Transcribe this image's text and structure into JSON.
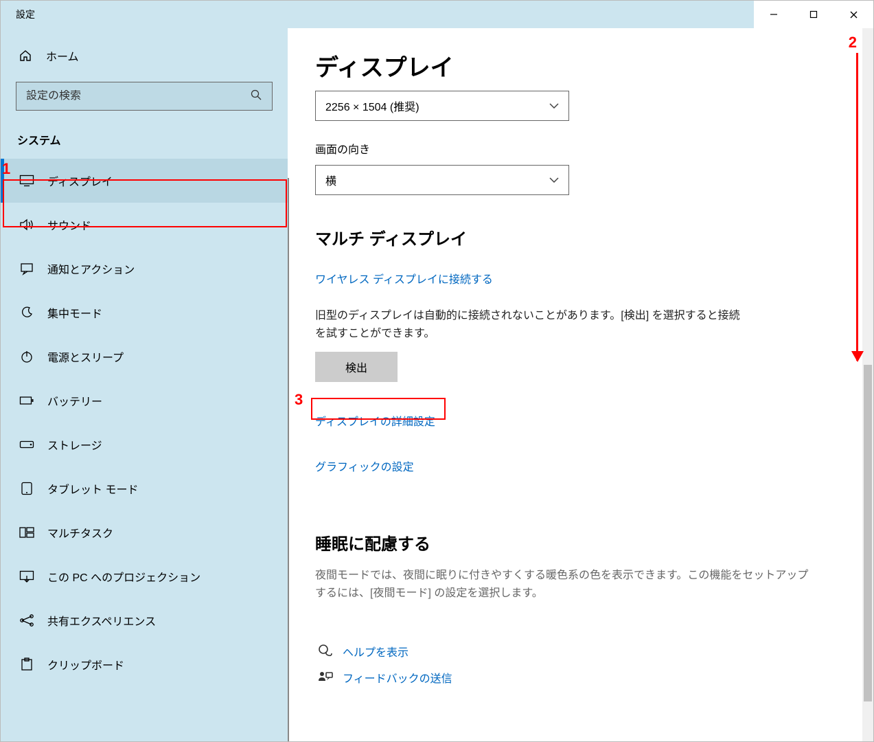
{
  "window": {
    "title": "設定"
  },
  "sidebar": {
    "home": "ホーム",
    "search_placeholder": "設定の検索",
    "section": "システム",
    "items": [
      {
        "id": "display",
        "label": "ディスプレイ",
        "selected": true
      },
      {
        "id": "sound",
        "label": "サウンド"
      },
      {
        "id": "notifications",
        "label": "通知とアクション"
      },
      {
        "id": "focus",
        "label": "集中モード"
      },
      {
        "id": "power",
        "label": "電源とスリープ"
      },
      {
        "id": "battery",
        "label": "バッテリー"
      },
      {
        "id": "storage",
        "label": "ストレージ"
      },
      {
        "id": "tablet",
        "label": "タブレット モード"
      },
      {
        "id": "multitask",
        "label": "マルチタスク"
      },
      {
        "id": "projection",
        "label": "この PC へのプロジェクション"
      },
      {
        "id": "shared",
        "label": "共有エクスペリエンス"
      },
      {
        "id": "clipboard",
        "label": "クリップボード"
      }
    ]
  },
  "content": {
    "title": "ディスプレイ",
    "resolution_value": "2256 × 1504 (推奨)",
    "orientation_label": "画面の向き",
    "orientation_value": "横",
    "multi_display_heading": "マルチ ディスプレイ",
    "wireless_link": "ワイヤレス ディスプレイに接続する",
    "detect_text": "旧型のディスプレイは自動的に接続されないことがあります。[検出] を選択すると接続を試すことができます。",
    "detect_button": "検出",
    "advanced_link": "ディスプレイの詳細設定",
    "graphics_link": "グラフィックの設定",
    "sleep_heading": "睡眠に配慮する",
    "sleep_text": "夜間モードでは、夜間に眠りに付きやすくする暖色系の色を表示できます。この機能をセットアップするには、[夜間モード] の設定を選択します。",
    "help_link": "ヘルプを表示",
    "feedback_link": "フィードバックの送信"
  },
  "annotations": {
    "n1": "1",
    "n2": "2",
    "n3": "3"
  }
}
